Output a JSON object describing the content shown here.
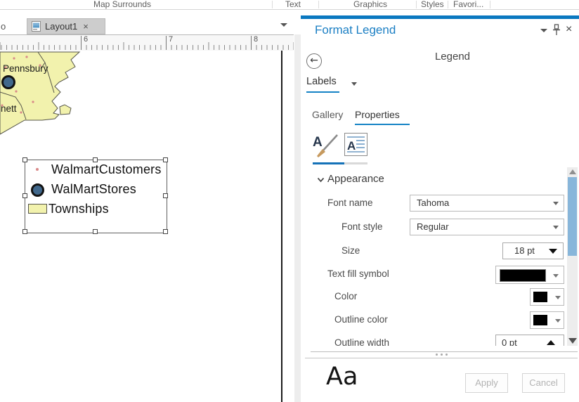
{
  "ribbon": {
    "groups": [
      {
        "label": "Map Surrounds"
      },
      {
        "label": "Text"
      },
      {
        "label": "Graphics"
      },
      {
        "label": "Styles"
      },
      {
        "label": "Favori..."
      }
    ]
  },
  "view_tabs": {
    "partial_tab": "o",
    "active_tab": "Layout1"
  },
  "ruler": {
    "numbers": [
      {
        "label": "6"
      },
      {
        "label": "7"
      },
      {
        "label": "8"
      }
    ]
  },
  "map": {
    "place_labels": [
      {
        "label": "Pennsbury"
      },
      {
        "label": "nett"
      }
    ]
  },
  "legend": {
    "items": [
      {
        "label": "WalmartCustomers",
        "symbol": "small-red-point"
      },
      {
        "label": "WalMartStores",
        "symbol": "dark-blue-circle"
      },
      {
        "label": "Townships",
        "symbol": "pale-yellow-polygon"
      }
    ]
  },
  "panel": {
    "title": "Format Legend",
    "heading": "Legend",
    "target_selector": "Labels",
    "tabs": [
      {
        "label": "Gallery"
      },
      {
        "label": "Properties",
        "active": true
      }
    ],
    "section_header": "Appearance",
    "fields": [
      {
        "label": "Font name",
        "value": "Tahoma"
      },
      {
        "label": "Font style",
        "value": "Regular"
      },
      {
        "label": "Size",
        "value": "18 pt"
      },
      {
        "label": "Text fill symbol",
        "value": "black"
      },
      {
        "label": "Color",
        "value": "black"
      },
      {
        "label": "Outline color",
        "value": "black"
      },
      {
        "label": "Outline width",
        "value": "0 pt"
      }
    ],
    "preview": "Aa",
    "apply_label": "Apply",
    "cancel_label": "Cancel"
  },
  "icons": {
    "close": "×",
    "back": "←",
    "letter_a": "A"
  },
  "colors": {
    "accent_blue": "#1b7fc4",
    "panel_top_bar": "#0a78c0",
    "scroll_thumb": "#88b6da",
    "township_fill": "#f2f2ad",
    "store_fill": "#41688c",
    "customer_dot": "#d98a8a",
    "swatch_black": "#000000"
  }
}
